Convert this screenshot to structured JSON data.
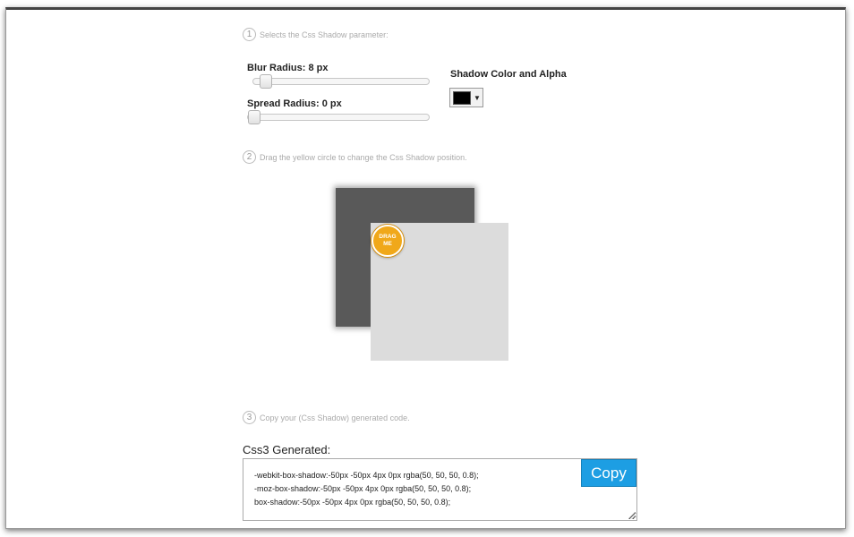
{
  "steps": {
    "step1": {
      "number": "1",
      "text": "Selects the Css Shadow parameter:"
    },
    "step2": {
      "number": "2",
      "text": "Drag the yellow circle to change the Css Shadow position."
    },
    "step3": {
      "number": "3",
      "text": "Copy your (Css Shadow) generated code."
    }
  },
  "controls": {
    "blur_label": "Blur Radius: 8 px",
    "blur_value_fraction": 0.04,
    "spread_label": "Spread Radius: 0 px",
    "spread_value_fraction": 0.0,
    "color_label": "Shadow Color and Alpha",
    "color_arrow": "▼"
  },
  "preview": {
    "drag_line1": "DRAG",
    "drag_line2": "ME"
  },
  "generated": {
    "title": "Css3 Generated:",
    "lines": [
      "-webkit-box-shadow:-50px -50px 4px 0px rgba(50, 50, 50, 0.8);",
      "-moz-box-shadow:-50px -50px 4px 0px rgba(50, 50, 50, 0.8);",
      "box-shadow:-50px -50px 4px 0px rgba(50, 50, 50, 0.8);"
    ],
    "copy_label": "Copy"
  },
  "colors": {
    "accent": "#1d9ee3",
    "drag_handle": "#f0a81a",
    "shadow": "#595959",
    "preview_box": "#dcdcdc"
  }
}
